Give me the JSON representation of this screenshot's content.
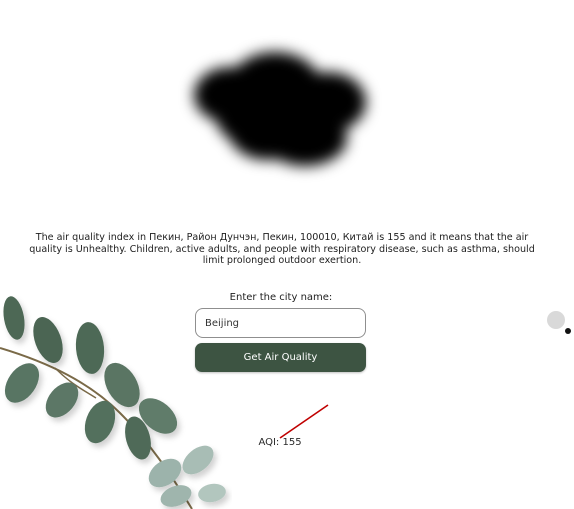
{
  "description": "The air quality index in Пекин, Район Дунчэн, Пекин, 100010, Китай is 155 and it means that the air quality is Unhealthy. Children, active adults, and people with respiratory disease, such as asthma, should limit prolonged outdoor exertion.",
  "form": {
    "city_label": "Enter the city name:",
    "city_value": "Beijing",
    "submit_label": "Get Air Quality"
  },
  "result": {
    "aqi_text": "AQI: 155"
  },
  "colors": {
    "button_bg": "#3d5442",
    "cloud": "#000000",
    "leaf": "#4f6a58"
  },
  "icons": {
    "cloud": "smog-cloud-icon",
    "plant": "eucalyptus-branch",
    "scroll": "scroll-knob"
  }
}
